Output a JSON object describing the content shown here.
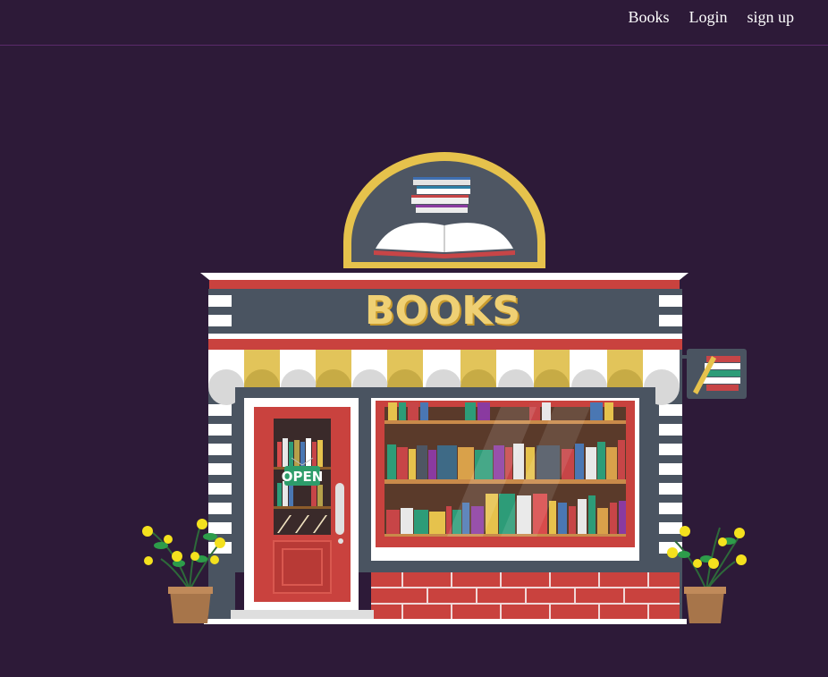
{
  "nav": {
    "items": [
      {
        "label": "Books"
      },
      {
        "label": "Login"
      },
      {
        "label": "sign up"
      }
    ]
  },
  "illustration": {
    "sign_text": "BOOKS",
    "door_sign": "OPEN"
  },
  "colors": {
    "background": "#2d1a38",
    "brick": "#c9423e",
    "awning_yellow": "#e2c45a",
    "slate": "#4a5461",
    "gold": "#e6c24c"
  }
}
